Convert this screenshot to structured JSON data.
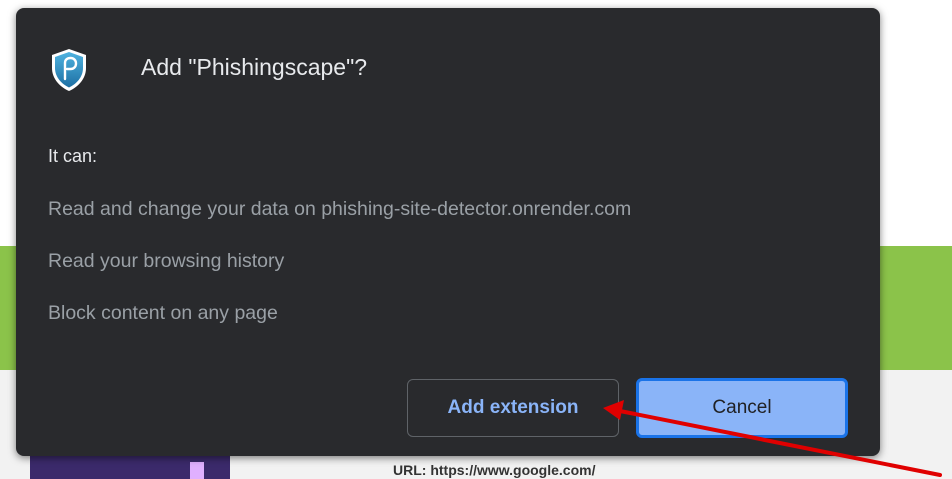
{
  "background": {
    "url_text": "URL: https://www.google.com/",
    "colors": {
      "green_band": "#8bc34a",
      "light_strip": "#f2f2f2"
    }
  },
  "dialog": {
    "title": "Add \"Phishingscape\"?",
    "icon": "shield-extension-icon",
    "it_can_label": "It can:",
    "permissions": [
      "Read and change your data on phishing-site-detector.onrender.com",
      "Read your browsing history",
      "Block content on any page"
    ],
    "add_button_label": "Add extension",
    "cancel_button_label": "Cancel",
    "colors": {
      "background": "#292a2d",
      "title_text": "#e8eaed",
      "permission_text": "#9aa0a6",
      "accent": "#8ab4f8",
      "focus_ring": "#1a73e8"
    }
  },
  "annotation": {
    "type": "arrow",
    "color": "#e00000",
    "points_to": "add-extension-button"
  }
}
